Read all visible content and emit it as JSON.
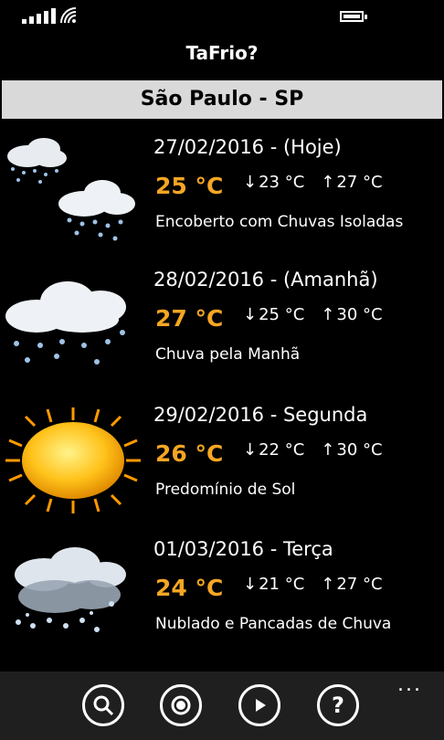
{
  "header": {
    "app_title": "TaFrio?",
    "city": "São Paulo - SP"
  },
  "forecast": [
    {
      "date": "27/02/2016 - (Hoje)",
      "temp": "25 °C",
      "min": "23 °C",
      "max": "27 °C",
      "desc": "Encoberto com Chuvas Isoladas",
      "icon": "rain-clouds-icon"
    },
    {
      "date": "28/02/2016 - (Amanhã)",
      "temp": "27 °C",
      "min": "25 °C",
      "max": "30 °C",
      "desc": "Chuva pela Manhã",
      "icon": "rain-cloud-icon"
    },
    {
      "date": "29/02/2016 - Segunda",
      "temp": "26 °C",
      "min": "22 °C",
      "max": "30 °C",
      "desc": "Predomínio de Sol",
      "icon": "sun-icon"
    },
    {
      "date": "01/03/2016 - Terça",
      "temp": "24 °C",
      "min": "21 °C",
      "max": "27 °C",
      "desc": "Nublado e Pancadas de Chuva",
      "icon": "cloud-showers-icon"
    }
  ],
  "appbar": {
    "buttons": [
      "search-icon",
      "location-icon",
      "play-icon",
      "help-icon"
    ],
    "help_glyph": "?",
    "more": "..."
  },
  "colors": {
    "temp": "#f5a623",
    "city_bar": "#d9d9d9",
    "appbar": "#1f1f1f"
  }
}
